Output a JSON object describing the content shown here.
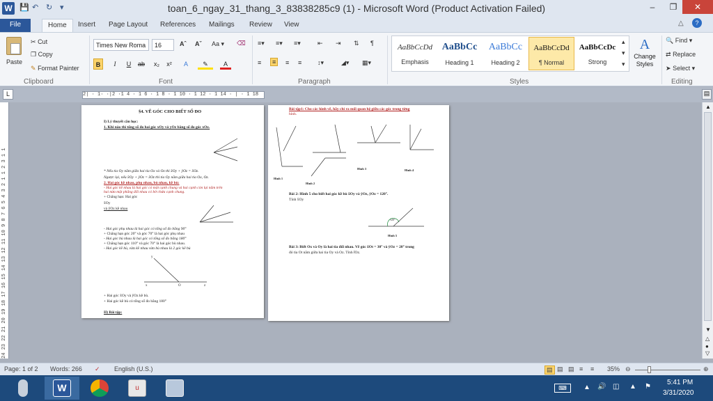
{
  "window": {
    "title": "toan_6_ngay_31_thang_3_83838285c9 (1) - Microsoft Word (Product Activation Failed)"
  },
  "tabs": [
    "File",
    "Home",
    "Insert",
    "Page Layout",
    "References",
    "Mailings",
    "Review",
    "View"
  ],
  "clipboard": {
    "paste": "Paste",
    "cut": "Cut",
    "copy": "Copy",
    "format_painter": "Format Painter",
    "label": "Clipboard"
  },
  "font": {
    "name": "Times New Roma",
    "size": "16",
    "label": "Font"
  },
  "paragraph": {
    "label": "Paragraph"
  },
  "styles": {
    "items": [
      {
        "sample": "AaBbCcDd",
        "name": "Emphasis"
      },
      {
        "sample": "AaBbCc",
        "name": "Heading 1"
      },
      {
        "sample": "AaBbCc",
        "name": "Heading 2"
      },
      {
        "sample": "AaBbCcDd",
        "name": "¶ Normal"
      },
      {
        "sample": "AaBbCcDc",
        "name": "Strong"
      }
    ],
    "change": "Change Styles",
    "label": "Styles"
  },
  "editing": {
    "find": "Find",
    "replace": "Replace",
    "select": "Select",
    "label": "Editing"
  },
  "ruler": {
    "h": "2| · 1· ·|2 ·1 4 · 1 6 · 1 8 · 1 10 · 1 12 · 1 14 · | · 1 18",
    "v": "24 23 22 21 20 19 18 17 16 15 14 13 12 11 10 9 8 7 6 5 4 3 2 1 1 2 3 1 1"
  },
  "page1": {
    "title": "§4. VẼ GÓC CHO BIẾT SỐ ĐO",
    "l1": "I) Lý thuyết cần học:",
    "l2": "1. Khi nào thì tổng số đo hai góc xOy và yOz bằng số đo góc xOz.",
    "l3": "* Nếu tia Oy nằm giữa hai tia Ox và Oz thì x̂Oy + ŷOz = x̂Oz.",
    "l4": "Ngược lại, nếu x̂Oy + ŷOz = x̂Oz thì tia Oy nằm giữa hai tia Ox, Oz.",
    "l5": "2. Hai góc kề nhau, phụ nhau, bù nhau, kề bù:",
    "l6": "- Hai góc kề nhau là hai góc có một cạnh chung và hai cạnh còn lại nằm trên",
    "l7": "hai nửa mặt phẳng đối nhau có bờ chứa cạnh chung.",
    "l8": "+ Chẳng hạn: Hai góc",
    "l9": "x̂Oy",
    "l10": "và ŷOz kề nhau",
    "l11": "- Hai góc phụ nhau là hai góc có tổng số đo bằng 90°",
    "l12": "+ Chẳng hạn góc 20° và góc 70° là hai góc phụ nhau",
    "l13": "- Hai góc bù nhau là hai góc có tổng số đo bằng 180°",
    "l14": "+ Chẳng hạn góc 110° và góc 70° là hai góc bù nhau.",
    "l15": "- Hai góc kề bù, vừa kề nhau vừa bù nhau là 2 góc kề bù",
    "l16": "+ Hai góc x̂Oy và ŷOz kề bù.",
    "l17": "+ Hai góc kề bù có tổng số đo bằng 180°",
    "l18": "II) Bài tập:",
    "lblx": "x",
    "lblo": "O",
    "lblz": "z",
    "lbly": "y"
  },
  "page2": {
    "b1a": "Bài tập1: Cho các hình vẽ, hãy chỉ ra mối quan hệ giữa các góc trong từng",
    "b1b": "hình.",
    "h1": "Hình 1",
    "h2": "Hình 2",
    "h3": "Hình 3",
    "h4": "Hình 4",
    "b2a": "Bài 2: Hình 5 cho biết hai góc kề bù x̂Oy và ŷOz, ŷOz = 120°.",
    "b2b": "Tính x̂Oy",
    "h5": "Hình 5",
    "a120": "120°",
    "b3a": "Bài 3: Biết Ox và Oy là hai tia đối nhau. Vẽ góc x̂Ot = 30° và ŷOz = 20° trong",
    "b3b": "đó tia Ot nằm giữa hai tia Oy và Oz. Tính t̂Oz."
  },
  "status": {
    "page": "Page: 1 of 2",
    "words": "Words: 266",
    "lang": "English (U.S.)",
    "zoom": "35%"
  },
  "clock": {
    "time": "5:41 PM",
    "date": "3/31/2020"
  }
}
